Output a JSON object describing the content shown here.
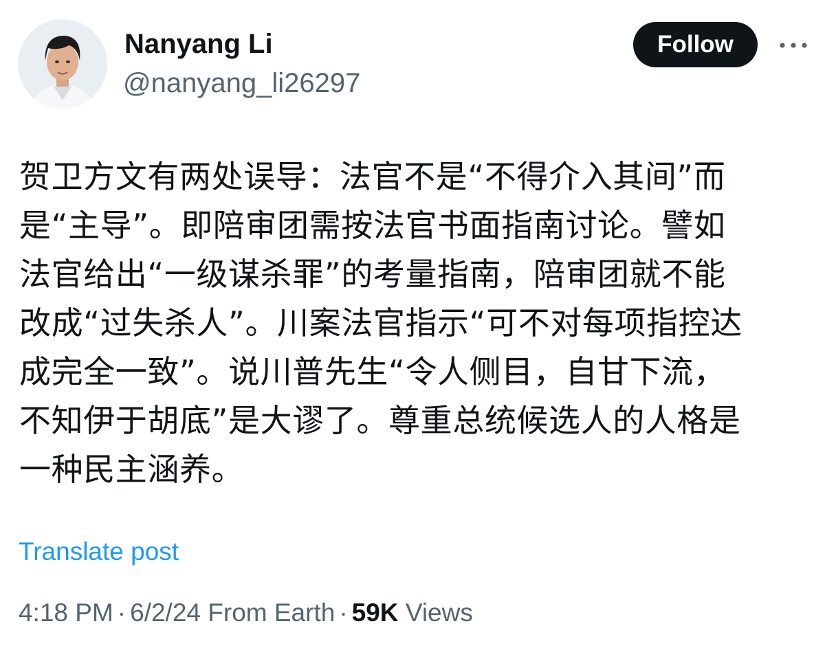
{
  "author": {
    "display_name": "Nanyang Li",
    "handle": "@nanyang_li26297",
    "avatar_icon": "user-avatar-photo"
  },
  "actions": {
    "follow_label": "Follow",
    "more_icon": "more-horizontal-icon"
  },
  "post": {
    "text": "贺卫方文有两处误导：法官不是“不得介入其间”而\n是“主导”。即陪审团需按法官书面指南讨论。譬如\n法官给出“一级谋杀罪”的考量指南，陪审团就不能\n改成“过失杀人”。川案法官指示“可不对每项指控达\n成完全一致”。说川普先生“令人侧目，自甘下流，\n不知伊于胡底”是大谬了。尊重总统候选人的人格是\n一种民主涵养。",
    "translate_label": "Translate post"
  },
  "meta": {
    "time": "4:18 PM",
    "date": "6/2/24",
    "source": "From Earth",
    "separator": "·",
    "views_count": "59K",
    "views_label": "Views"
  },
  "colors": {
    "text": "#0f1419",
    "secondary": "#536471",
    "link": "#1d9bf0",
    "button_bg": "#0f1419"
  }
}
